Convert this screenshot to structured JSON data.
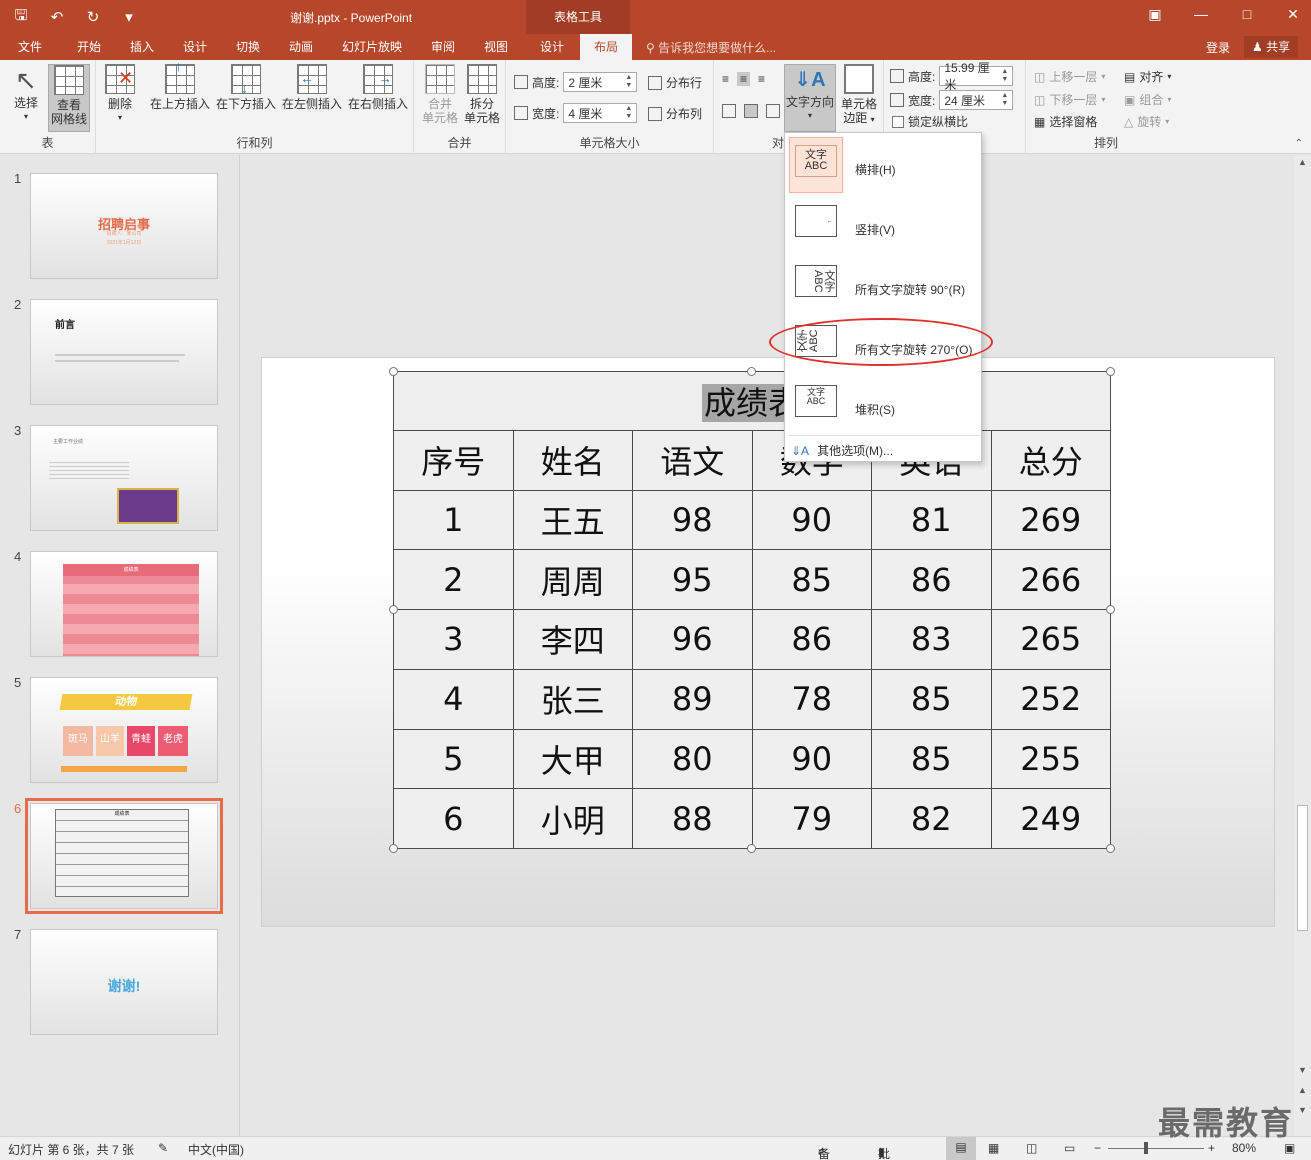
{
  "titlebar": {
    "filename": "谢谢.pptx - PowerPoint",
    "tool_tab": "表格工具",
    "qat": [
      "save-icon",
      "undo-icon",
      "redo-icon",
      "customize-icon"
    ],
    "window_controls": [
      "ribbon-display-icon",
      "minimize-icon",
      "maximize-icon",
      "close-icon"
    ]
  },
  "tabs": {
    "items": [
      "文件",
      "开始",
      "插入",
      "设计",
      "切换",
      "动画",
      "幻灯片放映",
      "审阅",
      "视图",
      "设计",
      "布局"
    ],
    "active": "布局",
    "tellme": "告诉我您想要做什么...",
    "login": "登录",
    "share": "共享"
  },
  "ribbon": {
    "table_group": {
      "label": "表",
      "select": "选择",
      "gridlines_1": "查看",
      "gridlines_2": "网格线"
    },
    "rows_group": {
      "label": "行和列",
      "delete": "删除",
      "insert_above": "在上方插入",
      "insert_below": "在下方插入",
      "insert_left": "在左侧插入",
      "insert_right": "在右侧插入"
    },
    "merge_group": {
      "label": "合并",
      "merge_1": "合并",
      "merge_2": "单元格",
      "split_1": "拆分",
      "split_2": "单元格"
    },
    "cellsize_group": {
      "label": "单元格大小",
      "height_label": "高度:",
      "height_value": "2 厘米",
      "width_label": "宽度:",
      "width_value": "4 厘米",
      "dist_rows": "分布行",
      "dist_cols": "分布列"
    },
    "align_group": {
      "label": "对",
      "text_dir_1": "文字方向",
      "margins_1": "单元格",
      "margins_2": "边距"
    },
    "tablesize_group": {
      "height_label": "高度:",
      "height_value": "15.99 厘米",
      "width_label": "宽度:",
      "width_value": "24 厘米",
      "lock": "锁定纵横比"
    },
    "arrange_group": {
      "label": "排列",
      "forward": "上移一层",
      "backward": "下移一层",
      "pane": "选择窗格",
      "align": "对齐",
      "group": "组合",
      "rotate": "旋转"
    }
  },
  "dropdown": {
    "items": [
      {
        "label": "横排(H)",
        "icon": "text-horizontal-icon",
        "glyph1": "文字",
        "glyph2": "ABC"
      },
      {
        "label": "竖排(V)",
        "icon": "text-vertical-icon",
        "glyph1": "",
        "glyph2": ""
      },
      {
        "label": "所有文字旋转 90°(R)",
        "icon": "text-rotate-90-icon",
        "glyph1": "文字",
        "glyph2": "ABC"
      },
      {
        "label": "所有文字旋转 270°(O)",
        "icon": "text-rotate-270-icon",
        "glyph1": "文字",
        "glyph2": "ABC"
      },
      {
        "label": "堆积(S)",
        "icon": "text-stacked-icon",
        "glyph1": "文字",
        "glyph2": "ABC"
      }
    ],
    "more": "其他选项(M)..."
  },
  "thumbnails": {
    "numbers": [
      "1",
      "2",
      "3",
      "4",
      "5",
      "6",
      "7"
    ],
    "slide1_title": "招聘启事",
    "slide1_sub": "招聘人：某公司",
    "slide1_date": "2021年1月12日",
    "slide2_title": "前言",
    "slide3_title": "主要工作业绩",
    "slide4_title": "成绩表",
    "slide5_title": "动物",
    "slide5_cards": [
      "斑马",
      "山羊",
      "青蛙",
      "老虎"
    ],
    "slide6_title": "成绩表",
    "slide7_title": "谢谢!"
  },
  "table": {
    "title": "成绩表",
    "headers": [
      "序号",
      "姓名",
      "语文",
      "数学",
      "英语",
      "总分"
    ],
    "rows": [
      [
        "1",
        "王五",
        "98",
        "90",
        "81",
        "269"
      ],
      [
        "2",
        "周周",
        "95",
        "85",
        "86",
        "266"
      ],
      [
        "3",
        "李四",
        "96",
        "86",
        "83",
        "265"
      ],
      [
        "4",
        "张三",
        "89",
        "78",
        "85",
        "252"
      ],
      [
        "5",
        "大甲",
        "80",
        "90",
        "85",
        "255"
      ],
      [
        "6",
        "小明",
        "88",
        "79",
        "82",
        "249"
      ]
    ]
  },
  "statusbar": {
    "slide_info": "幻灯片 第 6 张，共 7 张",
    "language": "中文(中国)",
    "notes": "备注",
    "comments": "批注",
    "zoom": "80%"
  },
  "watermark": "最需教育",
  "colors": {
    "accent": "#b7472a",
    "selection": "#e46c4a",
    "highlight_circle": "#e0302a"
  }
}
